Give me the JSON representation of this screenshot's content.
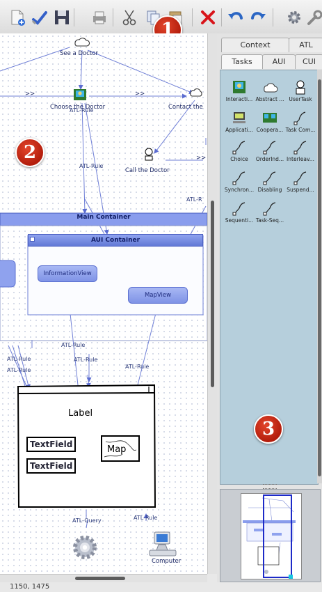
{
  "toolbar": {
    "icons": [
      "new-document-icon",
      "check-icon",
      "save-icon",
      "print-icon",
      "cut-icon",
      "copy-icon",
      "paste-icon",
      "delete-icon",
      "undo-icon",
      "redo-icon",
      "settings-icon",
      "wrench-icon"
    ],
    "delete_color": "#d8141a"
  },
  "badges": {
    "toolbar": "1",
    "canvas": "2",
    "palette": "3",
    "color": "#c42a12"
  },
  "tabs": {
    "row1": [
      "Context",
      "ATL"
    ],
    "row2": [
      "Tasks",
      "AUI",
      "CUI"
    ]
  },
  "palette": {
    "items": [
      {
        "label": "Interacti...",
        "icon": "interaction-task-icon"
      },
      {
        "label": "Abstract ...",
        "icon": "abstract-task-icon"
      },
      {
        "label": "UserTask",
        "icon": "user-task-icon"
      },
      {
        "label": "Applicati...",
        "icon": "application-task-icon"
      },
      {
        "label": "Coopera...",
        "icon": "cooperation-task-icon"
      },
      {
        "label": "Task Com...",
        "icon": "task-composition-icon"
      },
      {
        "label": "Choice",
        "icon": "link-icon"
      },
      {
        "label": "OrderInd...",
        "icon": "link-icon"
      },
      {
        "label": "Interleav...",
        "icon": "link-icon"
      },
      {
        "label": "Synchron...",
        "icon": "link-icon"
      },
      {
        "label": "Disabling",
        "icon": "link-icon"
      },
      {
        "label": "Suspend...",
        "icon": "link-icon"
      },
      {
        "label": "Sequenti...",
        "icon": "link-icon"
      },
      {
        "label": "Task-Seq...",
        "icon": "link-icon"
      }
    ],
    "background": "#b6cfdc"
  },
  "diagram": {
    "tasks": {
      "see_doctor": "See a Doctor",
      "choose_doctor": "Choose the Doctor",
      "contact": "Contact the",
      "call_doctor": "Call the Doctor"
    },
    "operators": [
      ">>",
      ">>",
      ">>"
    ],
    "rules": {
      "r1": "ATL-Rule",
      "r2": "ATL-Rule",
      "r3": "ATL-R",
      "r4": "ATL-Rule",
      "r5": "ATL-Rule",
      "r6": "ATL-Rule",
      "r7": "ATL-Rule",
      "r8": "ATL-Rule",
      "r9": "ATL-Rule"
    },
    "query": "ATL-Query",
    "main_container": "Main Container",
    "aui_container": "AUI Container",
    "information_view": "InformationView",
    "map_view": "MapView",
    "cui": {
      "label": "Label",
      "textfield1": "TextField",
      "textfield2": "TextField",
      "map": "Map"
    },
    "computer": "Computer"
  },
  "status": {
    "coords": "1150, 1475"
  }
}
